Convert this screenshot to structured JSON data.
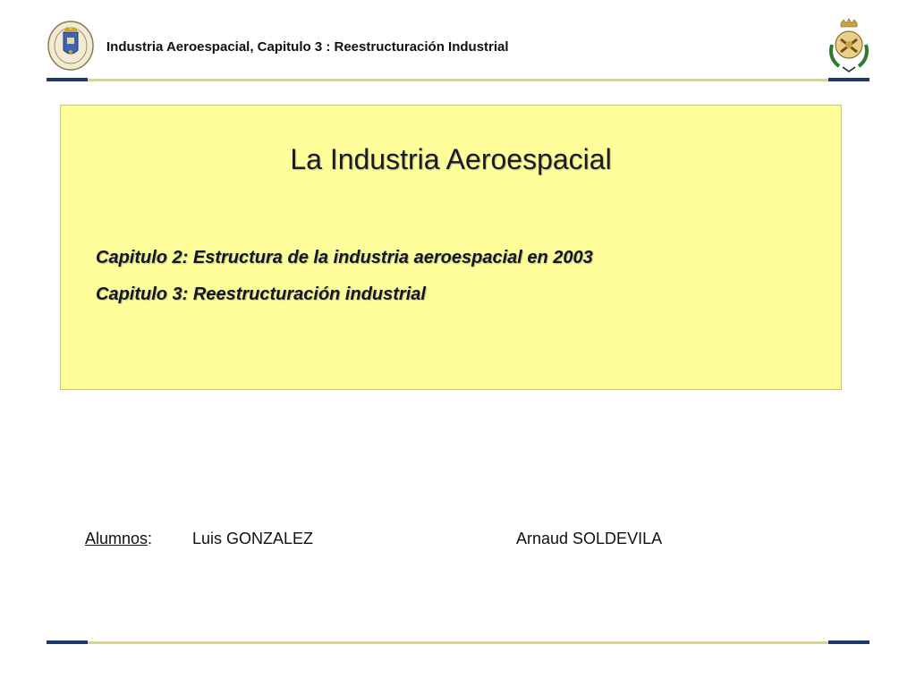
{
  "header": {
    "title": "Industria Aeroespacial, Capitulo 3 : Reestructuración Industrial",
    "left_logo": "university-crest-icon",
    "right_logo": "engineering-school-emblem-icon"
  },
  "title_box": {
    "title": "La Industria Aeroespacial",
    "chapters": [
      "Capitulo 2: Estructura de la industria aeroespacial en 2003",
      "Capitulo 3: Reestructuración industrial"
    ]
  },
  "students": {
    "label": "Alumnos",
    "separator": ":",
    "names": [
      "Luis GONZALEZ",
      "Arnaud SOLDEVILA"
    ]
  },
  "colors": {
    "title_box_bg": "#fdfe9a",
    "rule_accent": "#1f3a6a",
    "rule_line": "#d6d29a"
  }
}
